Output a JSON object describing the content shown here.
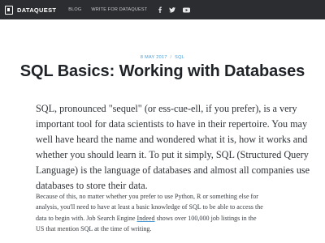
{
  "header": {
    "brand": "DATAQUEST",
    "nav": [
      "BLOG",
      "WRITE FOR DATAQUEST"
    ],
    "social": [
      "facebook-icon",
      "twitter-icon",
      "youtube-icon"
    ],
    "background_color": "#2c2d30"
  },
  "article": {
    "date": "8 MAY 2017",
    "separator": "/",
    "category": "SQL",
    "title": "SQL Basics: Working with Databases",
    "lead_lines": [
      "SQL, pronounced \"sequel\" (or ess-cue-ell, if you prefer), is a very",
      "important tool for data scientists to have in their repertoire. You may",
      "well have heard the name and wondered what it is, how it works and",
      "whether you should learn it. To put it simply, SQL (Structured Query",
      "Language) is the language of databases and almost all companies use",
      "databases to store their data."
    ],
    "body": {
      "line1": "Because of this, no matter whether you prefer to use Python, R or something else for",
      "line2": "analysis, you'll need to have at least a basic knowledge of SQL to be able to access the",
      "line3_before": "data to begin with. Job Search Engine ",
      "line3_link": "Indeed",
      "line3_after": " shows over 100,000 job listings in the",
      "line4": "US that mention SQL at the time of writing."
    },
    "accent_color": "#4a9bd6"
  }
}
